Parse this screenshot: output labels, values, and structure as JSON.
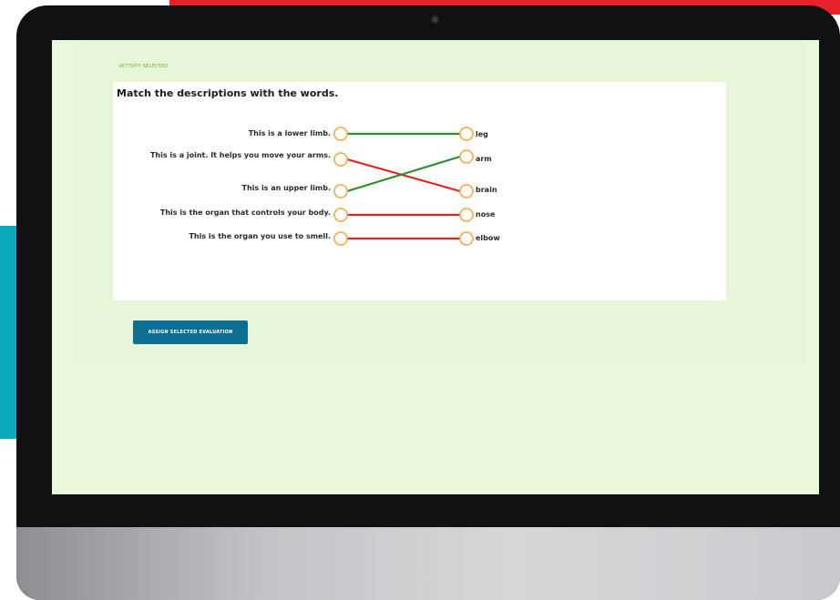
{
  "breadcrumb": "ACTIVITY SELECTED",
  "exercise": {
    "title": "Match the descriptions with the words.",
    "descriptions": [
      "This is a lower limb.",
      "This is a joint. It helps you move your arms.",
      "This is an upper limb.",
      "This is the organ that controls your body.",
      "This is the organ you use to smell."
    ],
    "words": [
      "leg",
      "arm",
      "brain",
      "nose",
      "elbow"
    ],
    "matches": [
      {
        "from": 0,
        "to": 0,
        "correct": true
      },
      {
        "from": 1,
        "to": 2,
        "correct": false
      },
      {
        "from": 2,
        "to": 1,
        "correct": true
      },
      {
        "from": 3,
        "to": 3,
        "correct": false
      },
      {
        "from": 4,
        "to": 4,
        "correct": false
      }
    ]
  },
  "assign_button_label": "ASSIGN SELECTED EVALUATION",
  "colors": {
    "correct_line": "#2e8b2e",
    "wrong_line": "#e02424",
    "node_stroke": "#f2b25a",
    "button": "#0b6f93",
    "screen_bg": "#eaf8dc",
    "accent_red": "#e8202a",
    "accent_teal": "#0aa8b8"
  },
  "icons": {
    "camera": "webcam-icon",
    "node": "connector-circle-icon"
  }
}
